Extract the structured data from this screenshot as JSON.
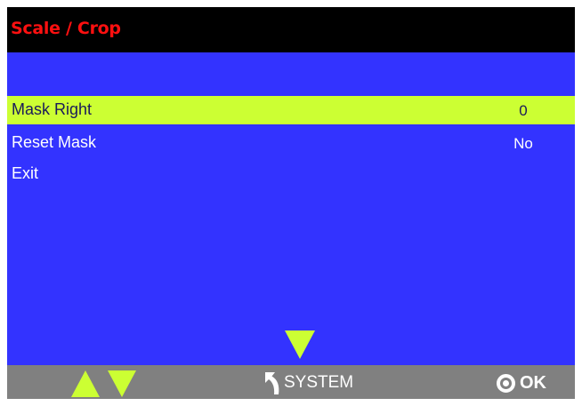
{
  "window": {
    "title": "Scale / Crop",
    "title_color": "#ff1010"
  },
  "colors": {
    "title_bar": "#000000",
    "menu_background": "#3333ff",
    "selection": "#ccff33",
    "footer": "#808080",
    "text": "#ffffff"
  },
  "menu": {
    "items": [
      {
        "label": "Mask Right",
        "value": "0",
        "selected": true
      },
      {
        "label": "Reset Mask",
        "value": "No",
        "selected": false
      },
      {
        "label": "Exit",
        "value": "",
        "selected": false
      }
    ],
    "scroll_indicator_icon": "triangle-down-icon"
  },
  "footer": {
    "nav_icons": [
      "triangle-up-icon",
      "triangle-down-icon"
    ],
    "back_icon": "back-arrow-icon",
    "back_label": "SYSTEM",
    "ok_icon": "circle-dot-icon",
    "ok_label": "OK"
  }
}
